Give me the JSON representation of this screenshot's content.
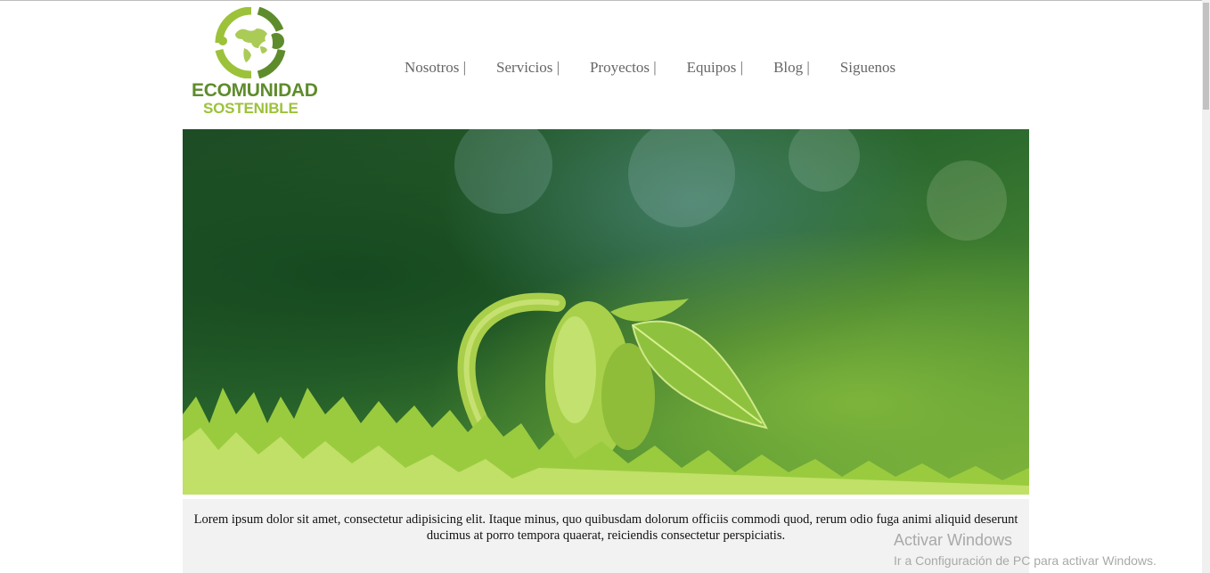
{
  "logo": {
    "line1": "ECOMUNIDAD",
    "line2": "SOSTENIBLE"
  },
  "nav": {
    "items": [
      {
        "label": "Nosotros |"
      },
      {
        "label": "Servicios |"
      },
      {
        "label": "Proyectos |"
      },
      {
        "label": "Equipos |"
      },
      {
        "label": "Blog |"
      },
      {
        "label": "Siguenos"
      }
    ]
  },
  "hero": {
    "image": "seedling-sprout-photo"
  },
  "caption": {
    "text": "Lorem ipsum dolor sit amet, consectetur adipisicing elit. Itaque minus, quo quibusdam dolorum officiis commodi quod, rerum odio fuga animi aliquid deserunt ducimus at porro tempora quaerat, reiciendis consectetur perspiciatis."
  },
  "windows_watermark": {
    "title": "Activar Windows",
    "subtitle": "Ir a Configuración de PC para activar Windows."
  },
  "colors": {
    "logo_dark_green": "#5e8c2c",
    "logo_light_green": "#9cc23a",
    "nav_text": "#666666",
    "caption_bg": "#f2f2f2"
  }
}
